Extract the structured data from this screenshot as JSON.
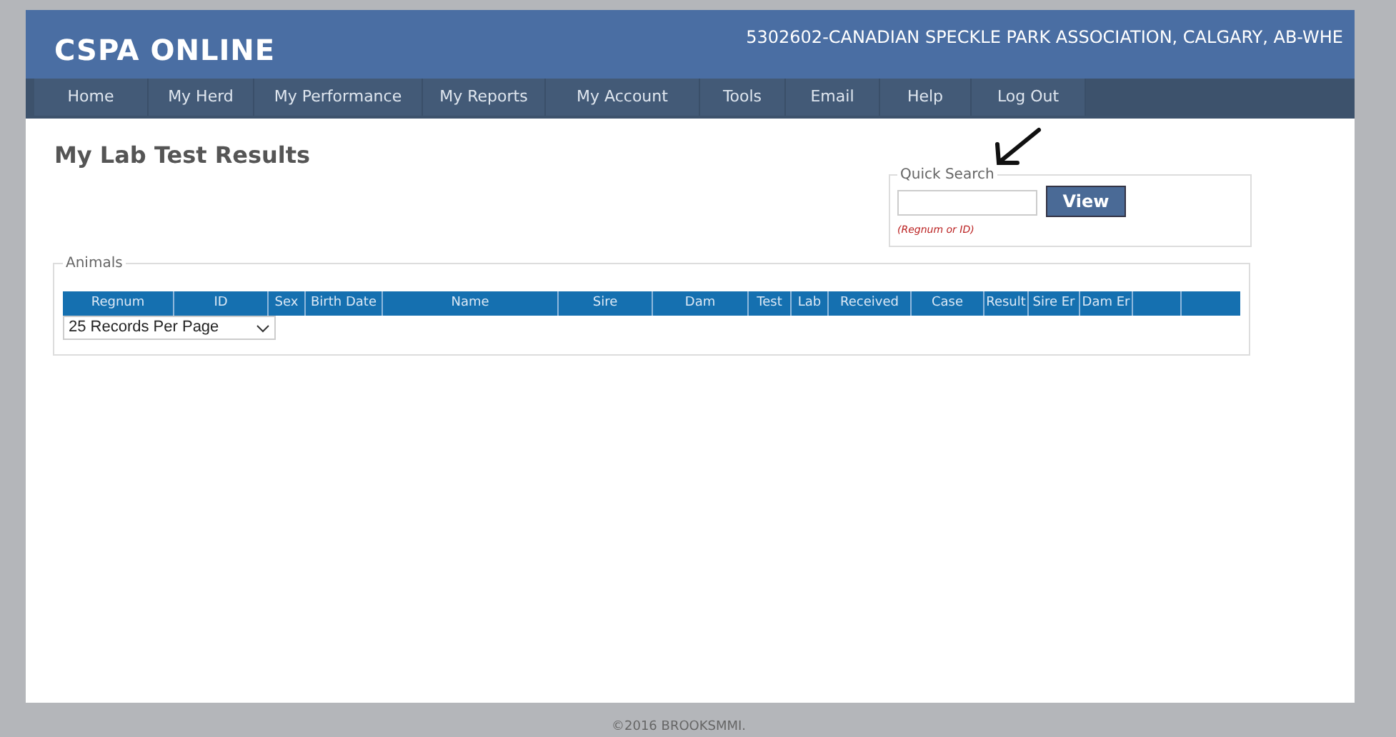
{
  "header": {
    "logo": "CSPA ONLINE",
    "account": "5302602-CANADIAN SPECKLE PARK ASSOCIATION, CALGARY, AB-WHE"
  },
  "nav": {
    "items": [
      {
        "label": "Home"
      },
      {
        "label": "My Herd"
      },
      {
        "label": "My Performance"
      },
      {
        "label": "My Reports"
      },
      {
        "label": "My Account"
      },
      {
        "label": "Tools"
      },
      {
        "label": "Email"
      },
      {
        "label": "Help"
      },
      {
        "label": "Log Out"
      }
    ]
  },
  "page_title": "My Lab Test Results",
  "quick_search": {
    "legend": "Quick Search",
    "button": "View",
    "hint": "(Regnum or ID)"
  },
  "animals": {
    "legend": "Animals",
    "columns": [
      "Regnum",
      "ID",
      "Sex",
      "Birth Date",
      "Name",
      "Sire",
      "Dam",
      "Test",
      "Lab",
      "Received",
      "Case",
      "Result",
      "Sire Er",
      "Dam Er"
    ],
    "page_size": "25 Records Per Page"
  },
  "footer": "©2016 BROOKSMMI."
}
